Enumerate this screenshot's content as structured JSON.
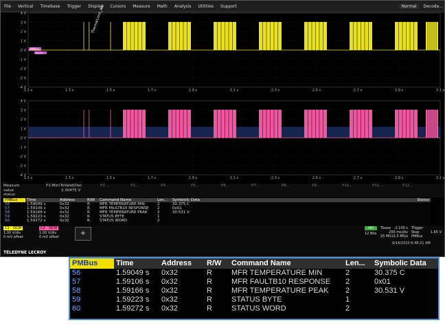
{
  "menu": {
    "items": [
      "File",
      "Vertical",
      "Timebase",
      "Trigger",
      "Display",
      "Cursors",
      "Measure",
      "Math",
      "Analysis",
      "Utilities",
      "Support"
    ],
    "mode": "Normal",
    "decode": "Decode..."
  },
  "graph": {
    "y_labels": [
      "4 V",
      "3 V",
      "2 V",
      "1 V",
      "0 V",
      "-1 V",
      "-2 V",
      "-3 V",
      "-4 V"
    ],
    "x_labels": [
      "1.1 s",
      "1.3 s",
      "1.5 s",
      "1.7 s",
      "1.9 s",
      "2.1 s",
      "2.3 s",
      "2.5 s",
      "2.7 s",
      "2.9 s",
      "3.1 s"
    ],
    "top_tag": "PMBus",
    "top_tag2": "Status",
    "top_annotation": "ThermalLimit_Attr",
    "colors": {
      "ch1": "#f7ee1f",
      "ch2": "#ff5aa8",
      "band": "#1b2a5a"
    }
  },
  "measure": {
    "title": "Measure",
    "p1": "P1:Min(ToValid(Dec",
    "value_label": "value",
    "value": "3.30475 V",
    "status_label": "status",
    "params": [
      "P2...",
      "P3...",
      "P4...",
      "P5...",
      "P6...",
      "P7...",
      "P8...",
      "P9...",
      "P10...",
      "P11...",
      "P12..."
    ]
  },
  "decode": {
    "headers": [
      "PMBus",
      "Time",
      "Address",
      "R/W",
      "Command Name",
      "Len...",
      "Symbolic Data",
      "Status"
    ],
    "rows": [
      [
        "56",
        "1.59049 s",
        "0x32",
        "R",
        "MFR TEMPERATURE MIN",
        "2",
        "30.375 C",
        ""
      ],
      [
        "57",
        "1.59106 s",
        "0x32",
        "R",
        "MFR FAULTB10 RESPONSE",
        "2",
        "0x01",
        ""
      ],
      [
        "58",
        "1.59166 s",
        "0x32",
        "R",
        "MFR TEMPERATURE PEAK",
        "2",
        "30.531 V",
        ""
      ],
      [
        "59",
        "1.59223 s",
        "0x32",
        "R",
        "STATUS BYTE",
        "1",
        "",
        ""
      ],
      [
        "60",
        "1.59272 s",
        "0x32",
        "R",
        "STATUS WORD",
        "2",
        "",
        ""
      ]
    ]
  },
  "status": {
    "c1": "C1",
    "c1_coupling": "DCM",
    "c1_scale": "1.00 V/div",
    "c1_offset": "0 mV offset",
    "c2": "C2",
    "c2_coupling": "DCM",
    "c2_scale": "1.00 V/div",
    "c2_offset": "0 mV offset",
    "add": "+",
    "hd": "HD",
    "bits": "12 Bits",
    "tbase_label": "Tbase",
    "tbase_val": "-2.100 s",
    "tbase_div": "200 ms/div",
    "samples": "25 MS",
    "rate": "12.5 MS/s",
    "trigger_label": "Trigger",
    "trigger_mode": "Stop",
    "trigger_src": "PMBus",
    "trigger_level": "1.65 V",
    "brand": "TELEDYNE LECROY",
    "datetime": "9/14/2020 6:48:21 AM"
  },
  "zoom": {
    "headers": [
      "PMBus",
      "Time",
      "Address",
      "R/W",
      "Command Name",
      "Len...",
      "Symbolic Data"
    ],
    "rows": [
      [
        "56",
        "1.59049 s",
        "0x32",
        "R",
        "MFR TEMPERATURE MIN",
        "2",
        "30.375 C"
      ],
      [
        "57",
        "1.59106 s",
        "0x32",
        "R",
        "MFR FAULTB10 RESPONSE",
        "2",
        "0x01"
      ],
      [
        "58",
        "1.59166 s",
        "0x32",
        "R",
        "MFR TEMPERATURE PEAK",
        "2",
        "30.531 V"
      ],
      [
        "59",
        "1.59223 s",
        "0x32",
        "R",
        "STATUS BYTE",
        "1",
        ""
      ],
      [
        "60",
        "1.59272 s",
        "0x32",
        "R",
        "STATUS WORD",
        "2",
        ""
      ]
    ]
  }
}
